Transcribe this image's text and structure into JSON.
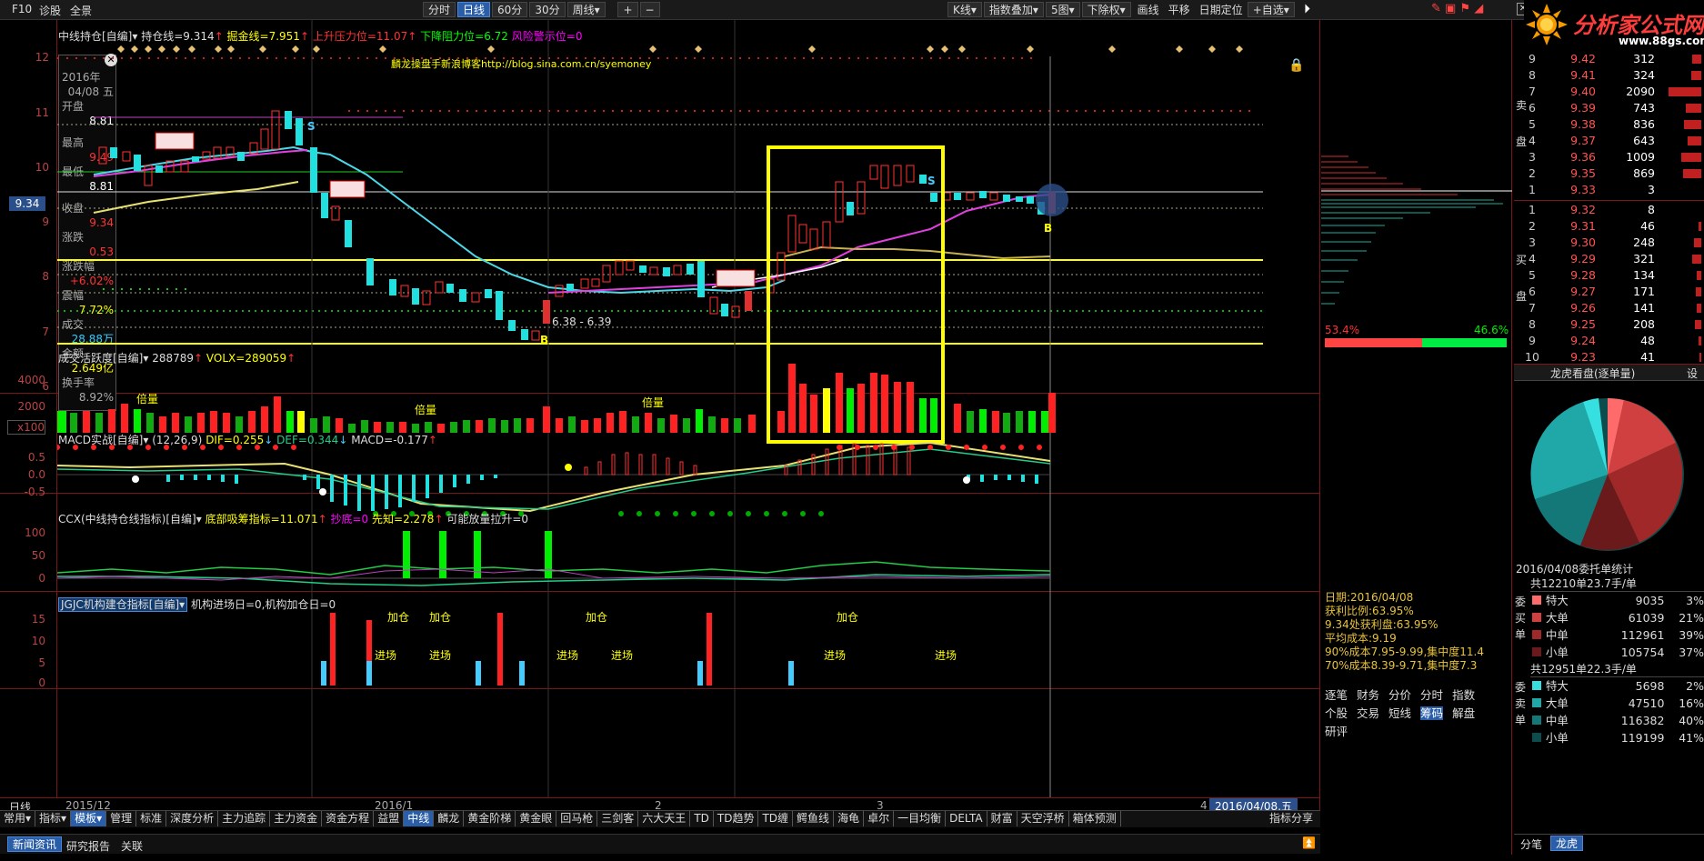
{
  "toolbar": {
    "f10": "F10",
    "diag": "诊股",
    "panorama": "全景",
    "periods": [
      "分时",
      "日线",
      "60分",
      "30分",
      "周线▾"
    ],
    "plus": "+",
    "minus": "−",
    "right": [
      "K线▾",
      "指数叠加▾",
      "5图▾",
      "下除权▾",
      "画线",
      "平移",
      "日期定位",
      "+自选▾"
    ],
    "close": "✕"
  },
  "main_title": {
    "name": "中线持仓[自编]▾",
    "hold": "持仓线=9.314",
    "dig": "掘金线=7.951",
    "press": "上升压力位=11.07",
    "support": "下降阻力位=6.72",
    "risk": "风险警示位=0",
    "blog": "麟龙操盘手新浪博客http://blog.sina.com.cn/syemoney"
  },
  "price_axis": [
    "12",
    "11",
    "10",
    "9",
    "8",
    "7",
    "6"
  ],
  "current_price_tag": "9.34",
  "info_box": {
    "year": "2016年",
    "date": "04/08 五",
    "open_l": "开盘",
    "open": "8.81",
    "high_l": "最高",
    "high": "9.49",
    "low_l": "最低",
    "low": "8.81",
    "close_l": "收盘",
    "close": "9.34",
    "chg_l": "涨跌",
    "chg": "0.53",
    "pct_l": "涨跌幅",
    "pct": "+6.02%",
    "amp_l": "震幅",
    "amp": "7.72%",
    "vol_l": "成交",
    "vol": "28.88万",
    "amt_l": "金额",
    "amt": "2.649亿",
    "turn_l": "换手率",
    "turn": "8.92%"
  },
  "price_labels": {
    "lo": "6.38 - 6.39",
    "b": "B",
    "s": "S"
  },
  "vol_panel": {
    "title": "成交活跃度[自编]▾",
    "v1": "288789",
    "v2": "VOLX=289059",
    "axis": [
      "4000",
      "2000",
      "x100"
    ],
    "labels": [
      "倍量",
      "倍量",
      "倍量"
    ]
  },
  "macd_panel": {
    "title": "MACD实战[自编]▾",
    "params": "(12,26,9)",
    "dif": "DIF=0.255",
    "def": "DEF=0.344",
    "macd": "MACD=-0.177",
    "axis": [
      "0.5",
      "0.0",
      "-0.5"
    ]
  },
  "ccx_panel": {
    "title": "CCX(中线持仓线指标)[自编]▾",
    "a": "底部吸筹指标=11.071",
    "b": "抄底=0",
    "c": "先知=2.278",
    "d": "可能放量拉升=0",
    "axis": [
      "100",
      "50",
      "0"
    ]
  },
  "jgjc_panel": {
    "title": "JGJC机构建仓指标[自编]▾",
    "a": "机构进场日=0,机构加仓日=0",
    "axis": [
      "15",
      "10",
      "5",
      "0"
    ],
    "enter": "进场",
    "add": "加仓"
  },
  "date_axis": {
    "label": "日线",
    "d1": "2015/12",
    "d2": "2016/1",
    "d3": "2",
    "d4": "3",
    "d5": "4",
    "cur": "2016/04/08,五"
  },
  "bottom_tabs": [
    "常用▾",
    "指标▾",
    "模板▾",
    "管理",
    "标准",
    "深度分析",
    "主力追踪",
    "主力资金",
    "资金方程",
    "益盟",
    "中线",
    "麟龙",
    "黄金阶梯",
    "黄金眼",
    "回马枪",
    "三剑客",
    "六大天王",
    "TD",
    "TD趋势",
    "TD缠",
    "鳄鱼线",
    "海龟",
    "卓尔",
    "一目均衡",
    "DELTA",
    "财富",
    "天空浮桥",
    "箱体预测"
  ],
  "bottom_right": "指标分享",
  "news_tabs": [
    "新闻资讯",
    "研究报告",
    "关联"
  ],
  "chips": {
    "pct_l": "53.4%",
    "pct_r": "46.6%",
    "date": "日期:2016/04/08",
    "ratio": "获利比例:63.95%",
    "profit": "9.34处获利盘:63.95%",
    "avg": "平均成本:9.19",
    "c90": "90%成本7.95-9.99,集中度11.4",
    "c70": "70%成本8.39-9.71,集中度7.3",
    "tabs1": [
      "逐笔",
      "财务",
      "分价",
      "分时",
      "指数"
    ],
    "tabs2": [
      "个股",
      "交易",
      "短线",
      "筹码",
      "解盘"
    ],
    "tab3": "研评"
  },
  "logo": {
    "text": "分析家公式网",
    "url": "www.88gs.com"
  },
  "sell_label": "卖盘",
  "buy_label": "买盘",
  "sell_rows": [
    [
      "9",
      "9.42",
      "312",
      10
    ],
    [
      "8",
      "9.41",
      "324",
      11
    ],
    [
      "7",
      "9.40",
      "2090",
      36
    ],
    [
      "6",
      "9.39",
      "743",
      17
    ],
    [
      "5",
      "9.38",
      "836",
      19
    ],
    [
      "4",
      "9.37",
      "643",
      15
    ],
    [
      "3",
      "9.36",
      "1009",
      22
    ],
    [
      "2",
      "9.35",
      "869",
      20
    ],
    [
      "1",
      "9.33",
      "3",
      0
    ]
  ],
  "buy_rows": [
    [
      "1",
      "9.32",
      "8",
      0
    ],
    [
      "2",
      "9.31",
      "46",
      3
    ],
    [
      "3",
      "9.30",
      "248",
      8
    ],
    [
      "4",
      "9.29",
      "321",
      10
    ],
    [
      "5",
      "9.28",
      "134",
      5
    ],
    [
      "6",
      "9.27",
      "171",
      6
    ],
    [
      "7",
      "9.26",
      "141",
      5
    ],
    [
      "8",
      "9.25",
      "208",
      7
    ],
    [
      "9",
      "9.24",
      "48",
      3
    ],
    [
      "10",
      "9.23",
      "41",
      2
    ]
  ],
  "dragon": {
    "title": "龙虎看盘(逐单量)",
    "set": "设",
    "date": "2016/04/08委托单统计",
    "buy_total": "共12210单23.7手/单",
    "sell_total": "共12951单22.3手/单",
    "buy_l": [
      "委",
      "买",
      "单"
    ],
    "sell_l": [
      "委",
      "卖",
      "单"
    ],
    "buy": [
      [
        "特大",
        "9035",
        "3%",
        "#ff6a6a"
      ],
      [
        "大单",
        "61039",
        "21%",
        "#d04040"
      ],
      [
        "中单",
        "112961",
        "39%",
        "#a02828"
      ],
      [
        "小单",
        "105754",
        "37%",
        "#6a1a1a"
      ]
    ],
    "sell": [
      [
        "特大",
        "5698",
        "2%",
        "#37e0e0"
      ],
      [
        "大单",
        "47510",
        "16%",
        "#20a8a8"
      ],
      [
        "中单",
        "116382",
        "40%",
        "#157878"
      ],
      [
        "小单",
        "119199",
        "41%",
        "#0c4c4c"
      ]
    ],
    "tabs": [
      "分笔",
      "龙虎"
    ]
  },
  "colors": {
    "up": "#ff2020",
    "down": "#20e0e0",
    "yellow": "#ffff00",
    "green": "#00e000"
  }
}
